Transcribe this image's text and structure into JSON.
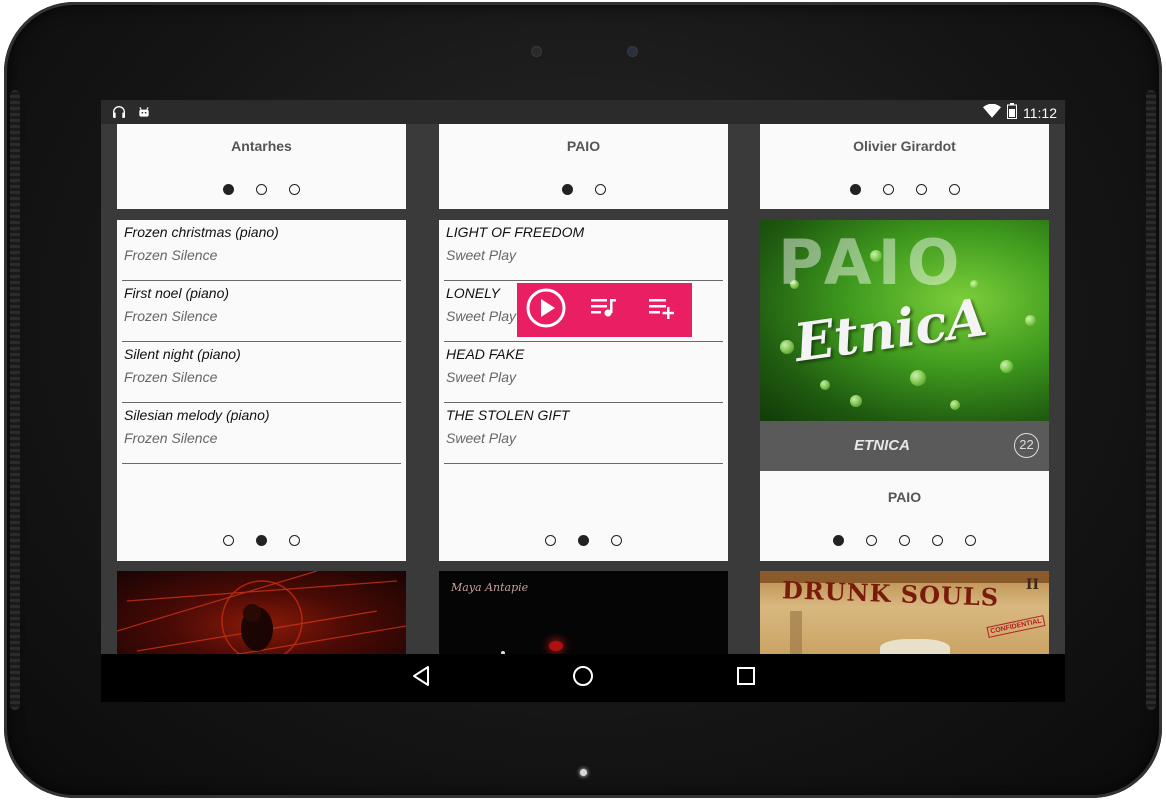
{
  "status_bar": {
    "time": "11:12",
    "icons": [
      "headphones-icon",
      "android-icon",
      "wifi-icon",
      "battery-icon"
    ]
  },
  "columns": [
    {
      "artist_card": {
        "title": "Antarhes",
        "dots": [
          true,
          false,
          false
        ]
      },
      "tracks_card": {
        "tracks": [
          {
            "title": "Frozen christmas (piano)",
            "album": "Frozen Silence"
          },
          {
            "title": "First noel (piano)",
            "album": "Frozen Silence"
          },
          {
            "title": "Silent night (piano)",
            "album": "Frozen Silence"
          },
          {
            "title": "Silesian melody (piano)",
            "album": "Frozen Silence"
          }
        ],
        "dots": [
          false,
          true,
          false
        ]
      }
    },
    {
      "artist_card": {
        "title": "PAIO",
        "dots": [
          true,
          false
        ]
      },
      "tracks_card": {
        "tracks": [
          {
            "title": "LIGHT OF FREEDOM",
            "album": "Sweet Play"
          },
          {
            "title": "LONELY",
            "album": "Sweet Play"
          },
          {
            "title": "HEAD FAKE",
            "album": "Sweet Play"
          },
          {
            "title": "THE STOLEN GIFT",
            "album": "Sweet Play"
          }
        ],
        "dots": [
          false,
          true,
          false
        ]
      }
    },
    {
      "artist_card": {
        "title": "Olivier Girardot",
        "dots": [
          true,
          false,
          false,
          false
        ]
      },
      "album_card": {
        "art_text_big": "PAIO",
        "art_text_script": "EtnicA",
        "album_name": "ETNICA",
        "track_count": "22",
        "artist": "PAIO",
        "dots": [
          true,
          false,
          false,
          false,
          false
        ]
      }
    }
  ],
  "popup_actions": [
    "play-icon",
    "queue-music-icon",
    "playlist-add-icon"
  ],
  "thumbnails": {
    "second_caption": "Maya Antapie",
    "third_caption": "DRUNK SOULS",
    "third_badge": "II",
    "third_stamp": "CONFIDENTIAL"
  },
  "colors": {
    "accent": "#e91e63",
    "card": "#fafafa",
    "background": "#3a3a3a"
  }
}
